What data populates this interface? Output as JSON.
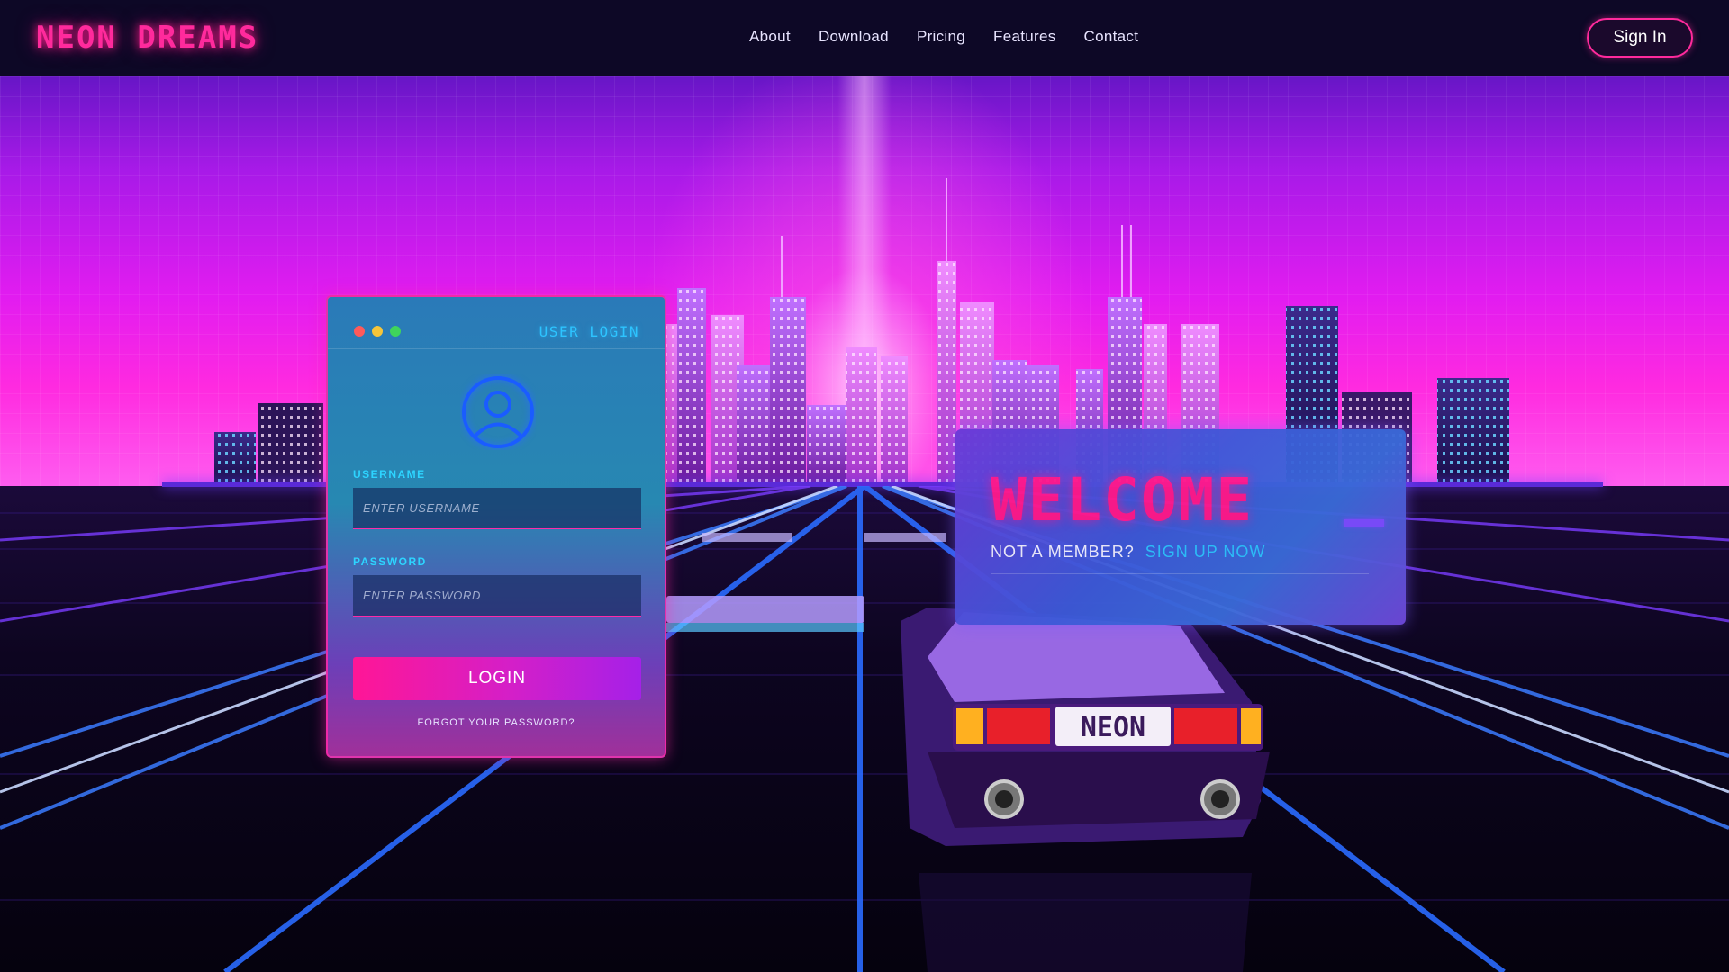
{
  "brand": {
    "logo": "NEON DREAMS",
    "accent": "#ff2a9c",
    "cyan": "#2dc4ff"
  },
  "nav": {
    "links": [
      "About",
      "Download",
      "Pricing",
      "Features",
      "Contact"
    ],
    "signin_label": "Sign In"
  },
  "login": {
    "title": "USER LOGIN",
    "avatar_icon": "user-circle-icon",
    "window_dots": [
      "#ff5a5a",
      "#f6c53a",
      "#3fd45c"
    ],
    "username_label": "USERNAME",
    "username_placeholder": "ENTER USERNAME",
    "username_value": "",
    "password_label": "PASSWORD",
    "password_placeholder": "ENTER PASSWORD",
    "password_value": "",
    "button_label": "LOGIN",
    "forgot_label": "FORGOT YOUR PASSWORD?"
  },
  "welcome": {
    "title": "WELCOME",
    "prompt": "NOT A MEMBER?",
    "signup_label": "SIGN UP NOW"
  },
  "scene": {
    "car_plate": "NEON"
  }
}
